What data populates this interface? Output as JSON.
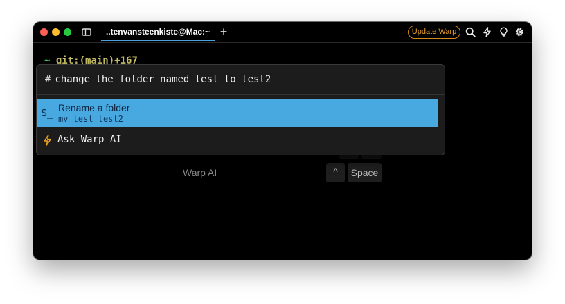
{
  "window": {
    "tab_title": "..tenvansteenkiste@Mac:~",
    "new_tab": "+",
    "update_button": "Update Warp",
    "toolbar_icons": [
      "search-icon",
      "bolt-icon",
      "lightbulb-icon",
      "gear-icon"
    ]
  },
  "terminal": {
    "prompt_arrow": "~",
    "prompt_git": "git:(main)+167"
  },
  "hint": {
    "label": "Warp AI",
    "keys": [
      "^",
      "Space"
    ]
  },
  "palette": {
    "query_prefix": "#",
    "query": "change the folder named test to test2",
    "suggestion": {
      "icon": "$_",
      "title": "Rename a folder",
      "command": "mv test test2"
    },
    "ask_ai": "Ask Warp AI"
  },
  "colors": {
    "accent": "#48a8e0",
    "update": "#e59a26",
    "bolt": "#e5a020"
  }
}
